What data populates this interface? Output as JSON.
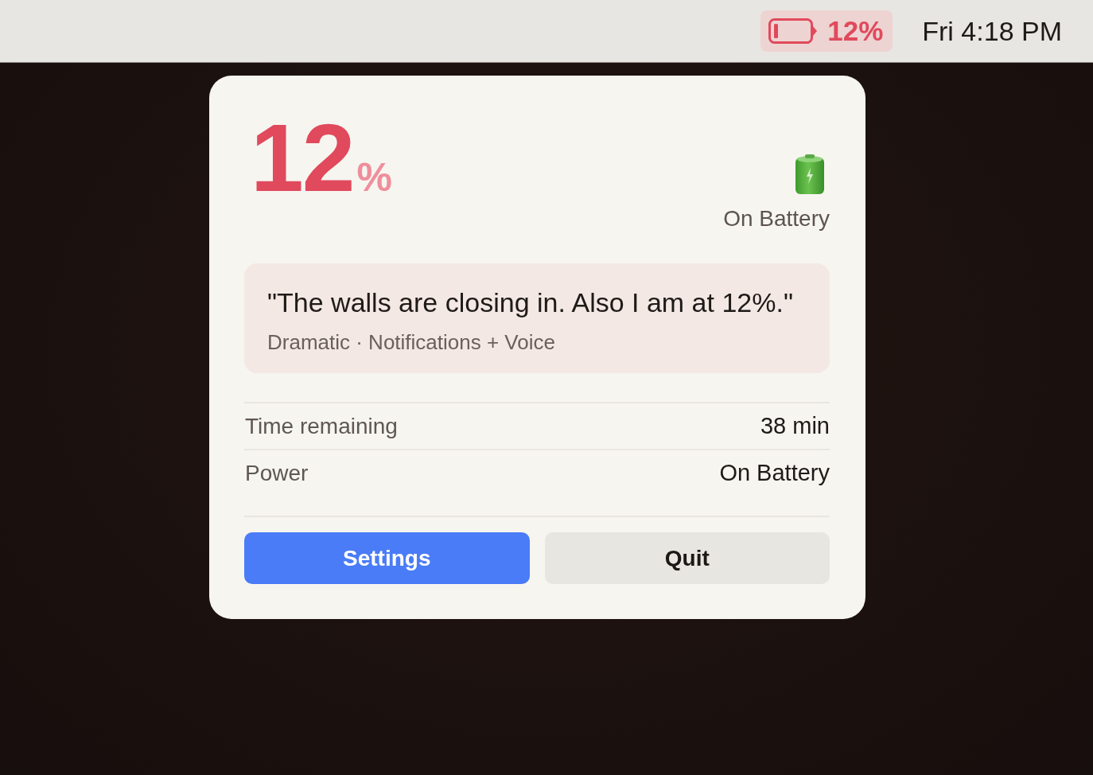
{
  "menu_bar": {
    "battery_status": {
      "text": "12%",
      "low": true
    },
    "clock": "Fri 4:18 PM"
  },
  "popover": {
    "charge": {
      "value": "12",
      "unit": "%",
      "low": true
    },
    "power_source": "On Battery",
    "alert": {
      "quote": "\"The walls are closing in. Also I am at 12%.\"",
      "meta": "Dramatic · Notifications + Voice"
    },
    "details": [
      {
        "label": "Time remaining",
        "value": "38 min"
      },
      {
        "label": "Power",
        "value": "On Battery"
      }
    ],
    "buttons": [
      {
        "label": "Settings",
        "kind": "primary"
      },
      {
        "label": "Quit",
        "kind": "secondary"
      }
    ]
  }
}
